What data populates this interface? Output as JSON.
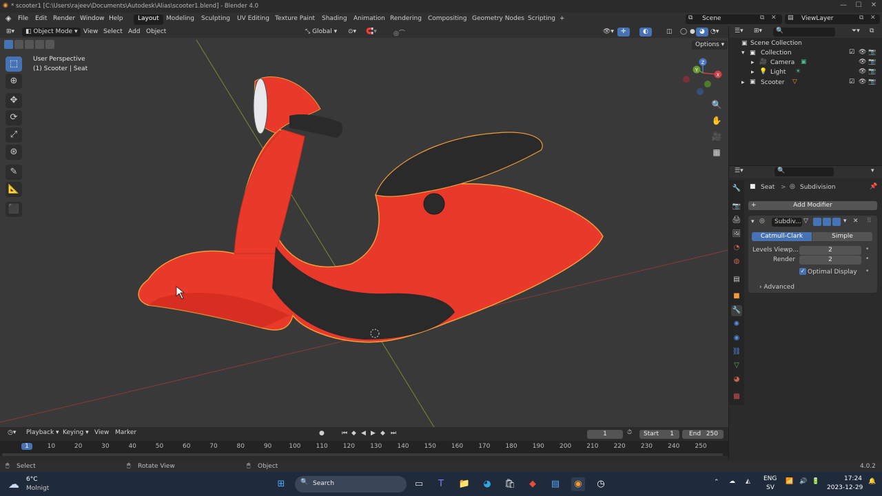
{
  "window": {
    "title": "* scooter1 [C:\\Users\\rajeev\\Documents\\Autodesk\\Alias\\scooter1.blend] - Blender 4.0",
    "minimize": "—",
    "maximize": "☐",
    "close": "✕"
  },
  "menu": {
    "items": [
      "File",
      "Edit",
      "Render",
      "Window",
      "Help"
    ],
    "workspaces": [
      "Layout",
      "Modeling",
      "Sculpting",
      "UV Editing",
      "Texture Paint",
      "Shading",
      "Animation",
      "Rendering",
      "Compositing",
      "Geometry Nodes",
      "Scripting"
    ],
    "add_workspace": "+",
    "scene": "Scene",
    "view_layer": "ViewLayer"
  },
  "viewport": {
    "mode": "Object Mode",
    "menus": [
      "View",
      "Select",
      "Add",
      "Object"
    ],
    "transform_orientation": "Global",
    "options_label": "Options",
    "info_line1": "User Perspective",
    "info_line2": "(1) Scooter | Seat",
    "gizmo_labels": {
      "z": "Z",
      "y": "Y",
      "x": "X"
    }
  },
  "outliner": {
    "scene_collection": "Scene Collection",
    "collection": "Collection",
    "items": [
      {
        "name": "Camera"
      },
      {
        "name": "Light"
      },
      {
        "name": "Scooter"
      }
    ]
  },
  "properties": {
    "object_name": "Seat",
    "breadcrumb_sep": ">",
    "modifier_context": "Subdivision",
    "add_modifier": "Add Modifier",
    "modifier_name": "Subdiv...",
    "type_catmull": "Catmull-Clark",
    "type_simple": "Simple",
    "levels_label": "Levels Viewp...",
    "levels_value": "2",
    "render_label": "Render",
    "render_value": "2",
    "optimal_display": "Optimal Display",
    "advanced": "Advanced"
  },
  "timeline": {
    "menus": [
      "Playback",
      "Keying",
      "View",
      "Marker"
    ],
    "current_frame": "1",
    "start_label": "Start",
    "start_value": "1",
    "end_label": "End",
    "end_value": "250",
    "ticks": [
      "1",
      "10",
      "20",
      "30",
      "40",
      "50",
      "60",
      "70",
      "80",
      "90",
      "100",
      "110",
      "120",
      "130",
      "140",
      "150",
      "160",
      "170",
      "180",
      "190",
      "200",
      "210",
      "220",
      "230",
      "240",
      "250"
    ]
  },
  "statusbar": {
    "select": "Select",
    "rotate_view": "Rotate View",
    "object": "Object",
    "version": "4.0.2"
  },
  "taskbar": {
    "temperature": "6°C",
    "weather": "Molnigt",
    "search": "Search",
    "lang1": "ENG",
    "lang2": "SV",
    "time": "17:24",
    "date": "2023-12-29"
  },
  "colors": {
    "scooter_red": "#e8392a",
    "seat_dark": "#2a2a2a",
    "accent_blue": "#4772b3",
    "selection_orange": "#f29d39"
  }
}
